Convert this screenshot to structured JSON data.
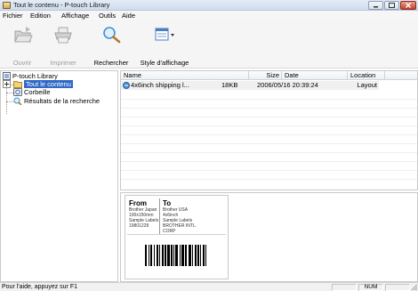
{
  "window": {
    "title": "Tout le contenu - P-touch Library"
  },
  "menu": {
    "items": [
      "Fichier",
      "Edition",
      "Affichage",
      "Outils",
      "Aide"
    ]
  },
  "toolbar": {
    "open_label": "Ouvrir",
    "print_label": "Imprimer",
    "search_label": "Rechercher",
    "view_style_label": "Style d'affichage"
  },
  "tree": {
    "root": "P-touch Library",
    "all_contents": "Tout le contenu",
    "trash": "Corbeille",
    "search_results": "Résultats de la recherche"
  },
  "list": {
    "columns": [
      "Name",
      "Size",
      "Date",
      "Location"
    ],
    "rows": [
      {
        "name": "4x6inch shipping l...",
        "size": "18KB",
        "date": "2006/05/16 20:39:24",
        "location": "Layout"
      }
    ]
  },
  "preview": {
    "from_heading": "From",
    "from_lines": [
      "Brother Japan",
      "100x150mm",
      "Sample Labels",
      "19801228"
    ],
    "to_heading": "To",
    "to_lines": [
      "Brother USA",
      "4x6inch",
      "Sample Labels",
      "BROTHER INTL.",
      "CORP"
    ]
  },
  "status": {
    "help_text": "Pour l'aide, appuyez sur F1",
    "num": "NUM"
  },
  "colors": {
    "selection": "#3169c6",
    "close_button": "#c4422a",
    "row_highlight": "#f0f0f0"
  }
}
